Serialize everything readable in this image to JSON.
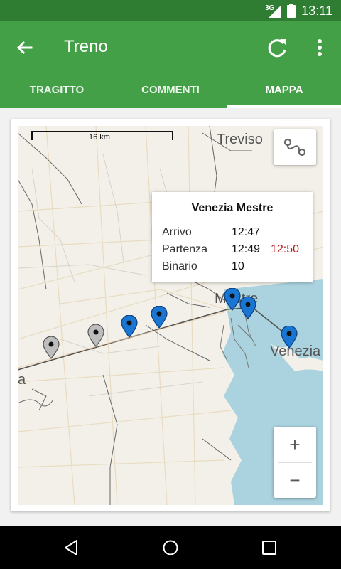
{
  "status_bar": {
    "network": "3G",
    "time": "13:11"
  },
  "app_bar": {
    "title": "Treno"
  },
  "tabs": [
    {
      "label": "TRAGITTO"
    },
    {
      "label": "COMMENTI"
    },
    {
      "label": "MAPPA"
    }
  ],
  "active_tab": "MAPPA",
  "map": {
    "scale": "16 km",
    "labels": {
      "treviso": "Treviso",
      "mestre": "Mestre",
      "venezia": "Venezia",
      "partial_left": "a"
    },
    "zoom_in": "+",
    "zoom_out": "−",
    "popup": {
      "station": "Venezia Mestre",
      "arrival_label": "Arrivo",
      "arrival": "12:47",
      "departure_label": "Partenza",
      "departure": "12:49",
      "departure_actual": "12:50",
      "platform_label": "Binario",
      "platform": "10"
    },
    "colors": {
      "passed_marker": "#bdbdbd",
      "upcoming_marker": "#1976d2",
      "water": "#aad3df",
      "delay": "#b71c1c"
    }
  }
}
